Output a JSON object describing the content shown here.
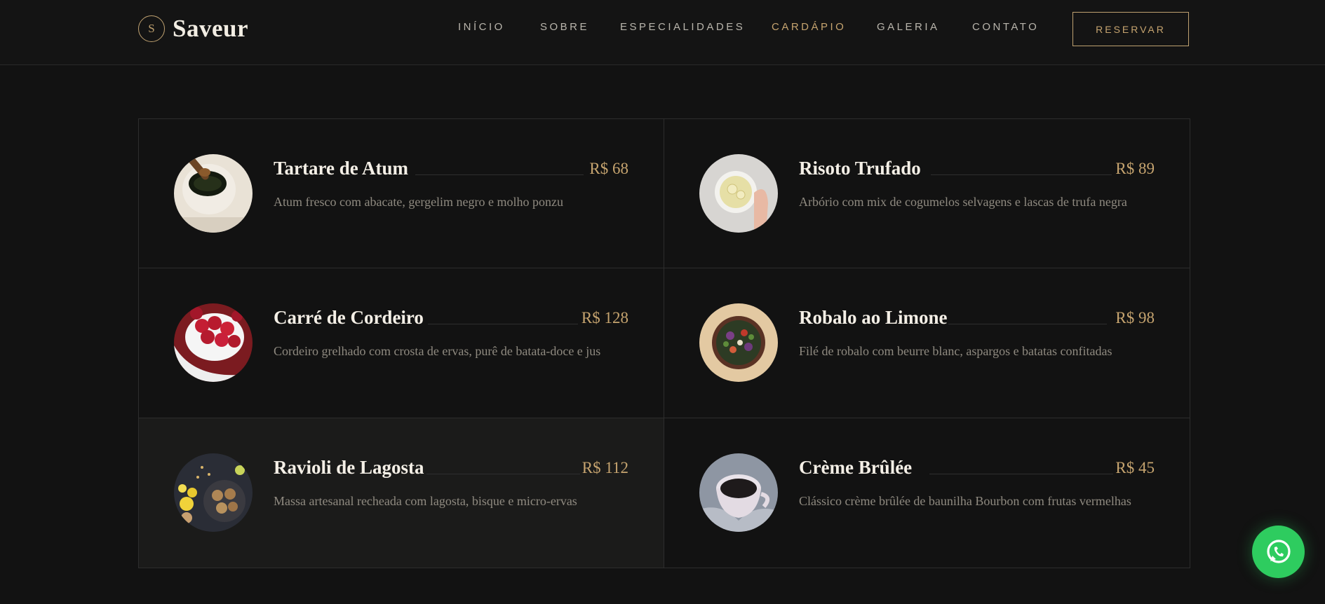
{
  "brand": {
    "logo_letter": "S",
    "name": "Saveur"
  },
  "nav": {
    "items": [
      "INÍCIO",
      "SOBRE",
      "ESPECIALIDADES",
      "CARDÁPIO",
      "GALERIA",
      "CONTATO"
    ],
    "active": "CARDÁPIO",
    "reserve_label": "RESERVAR"
  },
  "menu": {
    "items": [
      {
        "name": "Tartare de Atum",
        "price": "R$ 68",
        "description": "Atum fresco com abacate, gergelim negro e molho ponzu",
        "image_icon": "honey-jar-photo"
      },
      {
        "name": "Risoto Trufado",
        "price": "R$ 89",
        "description": "Arbório com mix de cogumelos selvagens e lascas de trufa negra",
        "image_icon": "lemon-tea-cup-photo"
      },
      {
        "name": "Carré de Cordeiro",
        "price": "R$ 128",
        "description": "Cordeiro grelhado com crosta de ervas, purê de batata-doce e jus",
        "image_icon": "raspberries-bowl-photo"
      },
      {
        "name": "Robalo ao Limone",
        "price": "R$ 98",
        "description": "Filé de robalo com beurre blanc, aspargos e batatas confitadas",
        "image_icon": "salad-bowl-photo"
      },
      {
        "name": "Ravioli de Lagosta",
        "price": "R$ 112",
        "description": "Massa artesanal recheada com lagosta, bisque e micro-ervas",
        "image_icon": "cookies-plate-photo"
      },
      {
        "name": "Crème Brûlée",
        "price": "R$ 45",
        "description": "Clássico crème brûlée de baunilha Bourbon com frutas vermelhas",
        "image_icon": "coffee-mug-photo"
      }
    ]
  },
  "colors": {
    "background": "#121212",
    "accent": "#c6a46f",
    "whatsapp": "#2ecc5f"
  },
  "floating_button": {
    "icon": "whatsapp-icon"
  }
}
